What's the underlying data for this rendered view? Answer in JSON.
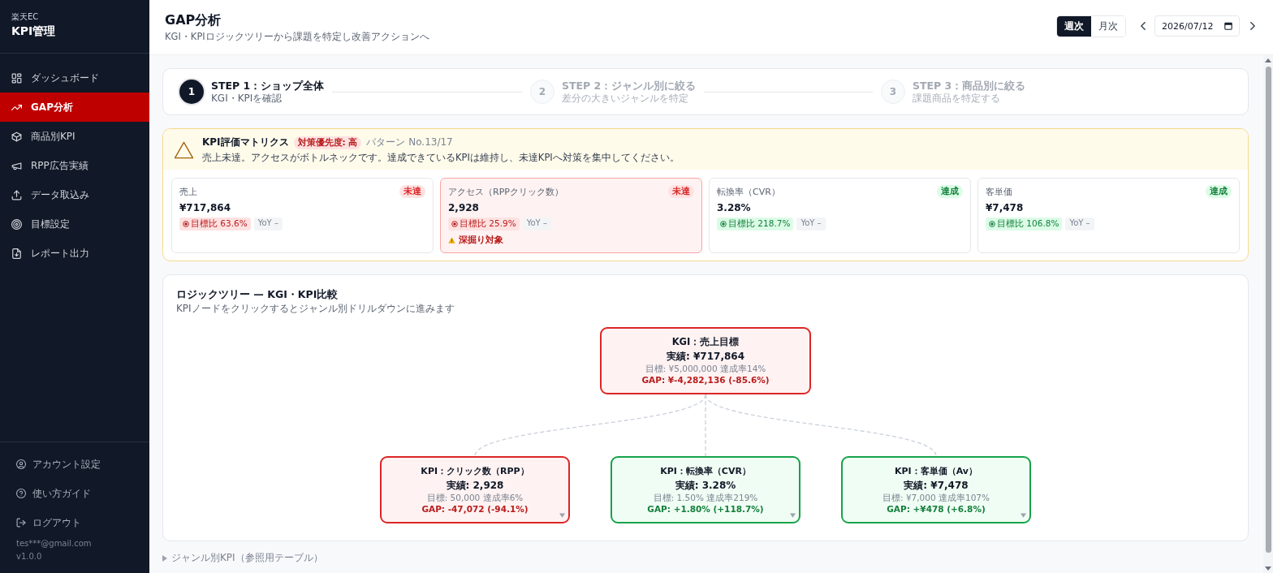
{
  "sidebar": {
    "brand_sub": "楽天EC",
    "brand_title": "KPI管理",
    "nav": [
      {
        "label": "ダッシュボード",
        "selected": false
      },
      {
        "label": "GAP分析",
        "selected": true
      },
      {
        "label": "商品別KPI",
        "selected": false
      },
      {
        "label": "RPP広告実績",
        "selected": false
      },
      {
        "label": "データ取込み",
        "selected": false
      },
      {
        "label": "目標設定",
        "selected": false
      },
      {
        "label": "レポート出力",
        "selected": false
      }
    ],
    "footer_links": [
      {
        "label": "アカウント設定"
      },
      {
        "label": "使い方ガイド"
      },
      {
        "label": "ログアウト"
      }
    ],
    "email": "tes***@gmail.com",
    "version": "v1.0.0"
  },
  "header": {
    "title": "GAP分析",
    "subtitle": "KGI・KPIロジックツリーから課題を特定し改善アクションへ",
    "period_tabs": [
      {
        "label": "週次",
        "selected": true
      },
      {
        "label": "月次",
        "selected": false
      }
    ],
    "date": "2026/07/12"
  },
  "stepper": {
    "steps": [
      {
        "number": "1",
        "title": "STEP 1：ショップ全体",
        "subtitle": "KGI・KPIを確認",
        "selected": true
      },
      {
        "number": "2",
        "title": "STEP 2：ジャンル別に絞る",
        "subtitle": "差分の大きいジャンルを特定",
        "selected": false
      },
      {
        "number": "3",
        "title": "STEP 3：商品別に絞る",
        "subtitle": "課題商品を特定する",
        "selected": false
      }
    ]
  },
  "kpi_matrix": {
    "title": "KPI評価マトリクス",
    "priority_badge": "対策優先度: 高",
    "pattern": "パターン No.13/17",
    "message": "売上未達。アクセスがボトルネックです。達成できているKPIは維持し、未達KPIへ対策を集中してください。",
    "cards": [
      {
        "label": "売上",
        "status": "未達",
        "achieved": false,
        "value": "¥717,864",
        "ratio": "目標比 63.6%",
        "yoy": "YoY –",
        "highlighted": false
      },
      {
        "label": "アクセス（RPPクリック数）",
        "status": "未達",
        "achieved": false,
        "value": "2,928",
        "ratio": "目標比 25.9%",
        "yoy": "YoY –",
        "highlighted": true,
        "flag": "深掘り対象"
      },
      {
        "label": "転換率（CVR）",
        "status": "達成",
        "achieved": true,
        "value": "3.28%",
        "ratio": "目標比 218.7%",
        "yoy": "YoY –",
        "highlighted": false
      },
      {
        "label": "客単価",
        "status": "達成",
        "achieved": true,
        "value": "¥7,478",
        "ratio": "目標比 106.8%",
        "yoy": "YoY –",
        "highlighted": false
      }
    ]
  },
  "logic_tree": {
    "title": "ロジックツリー — KGI・KPI比較",
    "hint": "KPIノードをクリックするとジャンル別ドリルダウンに進みます",
    "root": {
      "title": "KGI：売上目標",
      "actual": "実績: ¥717,864",
      "target": "目標: ¥5,000,000 達成率14%",
      "gap": "GAP: ¥-4,282,136 (-85.6%)",
      "achieved": false
    },
    "children": [
      {
        "title": "KPI：クリック数（RPP）",
        "actual": "実績: 2,928",
        "target": "目標: 50,000 達成率6%",
        "gap": "GAP: -47,072 (-94.1%)",
        "achieved": false
      },
      {
        "title": "KPI：転換率（CVR）",
        "actual": "実績: 3.28%",
        "target": "目標: 1.50% 達成率219%",
        "gap": "GAP: +1.80% (+118.7%)",
        "achieved": true
      },
      {
        "title": "KPI：客単価（Av）",
        "actual": "実績: ¥7,478",
        "target": "目標: ¥7,000 達成率107%",
        "gap": "GAP: +¥478 (+6.8%)",
        "achieved": true
      }
    ]
  },
  "genre_section": {
    "label": "ジャンル別KPI（参照用テーブル）",
    "expanded": false
  }
}
